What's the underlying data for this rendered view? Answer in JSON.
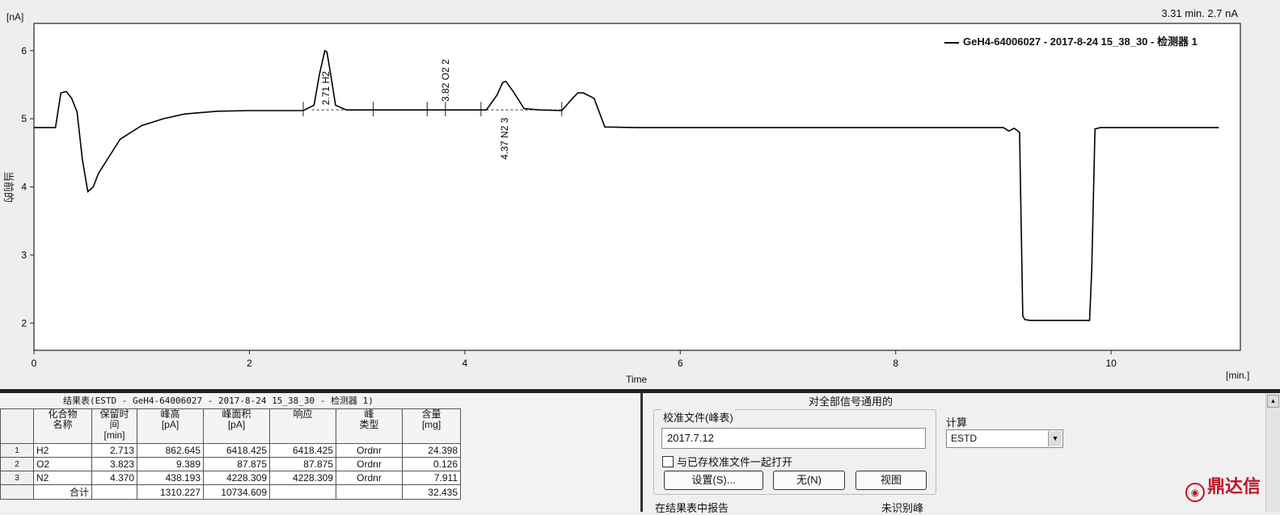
{
  "chart": {
    "cursor_readout": "3.31 min.  2.7 nA",
    "y_unit": "[nA]",
    "x_unit": "[min.]",
    "x_title": "Time",
    "y_title": "当前的",
    "legend_label": "GeH4-64006027 - 2017-8-24 15_38_30 - 检测器 1",
    "peak_labels": [
      "2.71 H2",
      "3.82 O2  2",
      "4.37 N2  3"
    ]
  },
  "chart_data": {
    "type": "line",
    "xlim": [
      0,
      11.2
    ],
    "ylim": [
      1.6,
      6.4
    ],
    "x_ticks": [
      0,
      2,
      4,
      6,
      8,
      10
    ],
    "y_ticks": [
      2,
      3,
      4,
      5,
      6
    ],
    "x_tick_labels": [
      "0",
      "2",
      "4",
      "6",
      "8",
      "10"
    ],
    "y_tick_labels": [
      "2",
      "3",
      "4",
      "5",
      "6"
    ],
    "xlabel": "Time",
    "ylabel": "当前的",
    "series": [
      {
        "name": "GeH4-64006027 - 2017-8-24 15_38_30 - 检测器 1",
        "x": [
          0,
          0.2,
          0.25,
          0.3,
          0.35,
          0.4,
          0.45,
          0.5,
          0.55,
          0.6,
          0.7,
          0.8,
          1.0,
          1.2,
          1.4,
          1.7,
          2.0,
          2.5,
          2.6,
          2.65,
          2.7,
          2.72,
          2.75,
          2.8,
          2.9,
          3.2,
          3.6,
          4.0,
          4.2,
          4.3,
          4.35,
          4.38,
          4.45,
          4.55,
          4.7,
          4.9,
          5.0,
          5.05,
          5.1,
          5.2,
          5.3,
          5.6,
          6.0,
          7.0,
          8.0,
          9.0,
          9.05,
          9.1,
          9.15,
          9.18,
          9.2,
          9.25,
          9.4,
          9.6,
          9.8,
          9.82,
          9.85,
          9.9,
          10.2,
          10.5,
          11.0
        ],
        "y": [
          4.87,
          4.87,
          5.38,
          5.4,
          5.3,
          5.1,
          4.4,
          3.93,
          4.0,
          4.2,
          4.45,
          4.7,
          4.9,
          5.0,
          5.07,
          5.11,
          5.12,
          5.12,
          5.2,
          5.65,
          6.0,
          5.98,
          5.7,
          5.2,
          5.13,
          5.13,
          5.13,
          5.13,
          5.13,
          5.35,
          5.53,
          5.55,
          5.4,
          5.15,
          5.13,
          5.12,
          5.3,
          5.38,
          5.38,
          5.3,
          4.88,
          4.87,
          4.87,
          4.87,
          4.87,
          4.87,
          4.82,
          4.86,
          4.8,
          2.1,
          2.05,
          2.04,
          2.04,
          2.04,
          2.04,
          2.8,
          4.85,
          4.87,
          4.87,
          4.87,
          4.87
        ]
      }
    ],
    "peaks": [
      {
        "label": "2.71 H2",
        "x": 2.71
      },
      {
        "label": "3.82 O2  2",
        "x": 3.82
      },
      {
        "label": "4.37 N2  3",
        "x": 4.37
      }
    ]
  },
  "results": {
    "title": "结果表(ESTD - GeH4-64006027 - 2017-8-24 15_38_30 - 检测器 1)",
    "headers": [
      [
        "化合物",
        "名称"
      ],
      [
        "保留时",
        "间",
        "[min]"
      ],
      [
        "峰高",
        "[pA]"
      ],
      [
        "峰面积",
        "[pA]"
      ],
      [
        "响应"
      ],
      [
        "峰",
        "类型"
      ],
      [
        "含量",
        "[mg]"
      ]
    ],
    "rows": [
      {
        "idx": "1",
        "name": "H2",
        "rt": "2.713",
        "height": "862.645",
        "area": "6418.425",
        "resp": "6418.425",
        "type": "Ordnr",
        "amount": "24.398"
      },
      {
        "idx": "2",
        "name": "O2",
        "rt": "3.823",
        "height": "9.389",
        "area": "87.875",
        "resp": "87.875",
        "type": "Ordnr",
        "amount": "0.126"
      },
      {
        "idx": "3",
        "name": "N2",
        "rt": "4.370",
        "height": "438.193",
        "area": "4228.309",
        "resp": "4228.309",
        "type": "Ordnr",
        "amount": "7.911"
      }
    ],
    "total": {
      "label": "合计",
      "height": "1310.227",
      "area": "10734.609",
      "amount": "32.435"
    }
  },
  "calibration": {
    "title": "对全部信号通用的",
    "file_group": "校准文件(峰表)",
    "file_value": "2017.7.12",
    "checkbox_label": "与已存校准文件一起打开",
    "buttons": {
      "settings": "设置(S)...",
      "none": "无(N)",
      "view": "视图"
    },
    "calc_label": "计算",
    "calc_value": "ESTD",
    "bottom_left": "在结果表中报告",
    "bottom_right": "未识别峰"
  },
  "watermark": "鼎达信"
}
